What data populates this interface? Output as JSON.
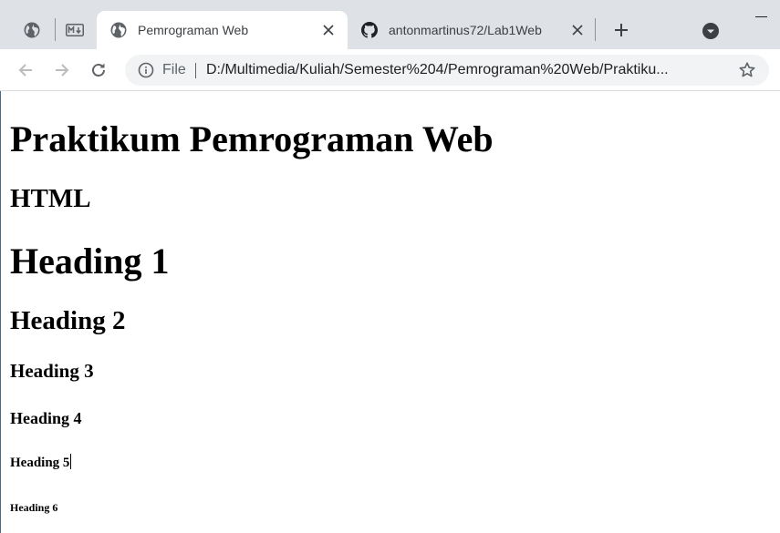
{
  "browser": {
    "tabs": [
      {
        "type": "pinned",
        "icon": "globe-icon"
      },
      {
        "type": "pinned",
        "icon": "markdown-icon"
      },
      {
        "title": "Pemrograman Web",
        "icon": "globe-icon",
        "active": true
      },
      {
        "title": "antonmartinus72/Lab1Web",
        "icon": "github-icon",
        "active": false
      }
    ],
    "address": {
      "scheme_label": "File",
      "url": "D:/Multimedia/Kuliah/Semester%204/Pemrograman%20Web/Praktiku..."
    }
  },
  "page": {
    "title": "Praktikum Pemrograman Web",
    "subtitle": "HTML",
    "headings": [
      "Heading 1",
      "Heading 2",
      "Heading 3",
      "Heading 4",
      "Heading 5",
      "Heading 6"
    ]
  },
  "colors": {
    "tabstrip_bg": "#dee1e6",
    "omnibox_bg": "#f1f3f4",
    "icon": "#5f6368"
  }
}
